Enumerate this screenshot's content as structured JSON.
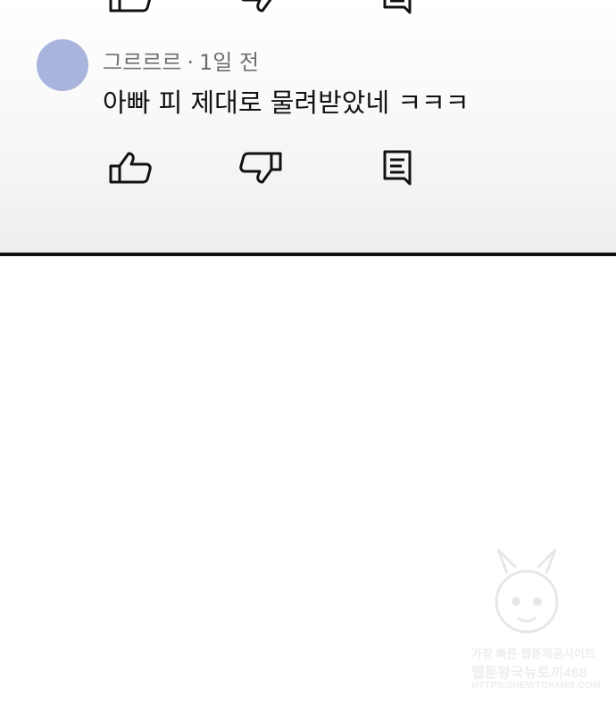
{
  "comment": {
    "author": "그르르르",
    "separator": "·",
    "time": "1일 전",
    "text": "아빠 피 제대로 물려받았네 ㅋㅋㅋ",
    "avatar_color": "#a9b4dc"
  },
  "actions": {
    "like_icon": "thumbs-up-icon",
    "dislike_icon": "thumbs-down-icon",
    "reply_icon": "reply-icon"
  },
  "watermark": {
    "line1": "가장 빠른 웹툰제공사이트",
    "line2": "웹툰왕국뉴토끼468",
    "line3": "HTTPS://NEWTOKI468.COM"
  }
}
